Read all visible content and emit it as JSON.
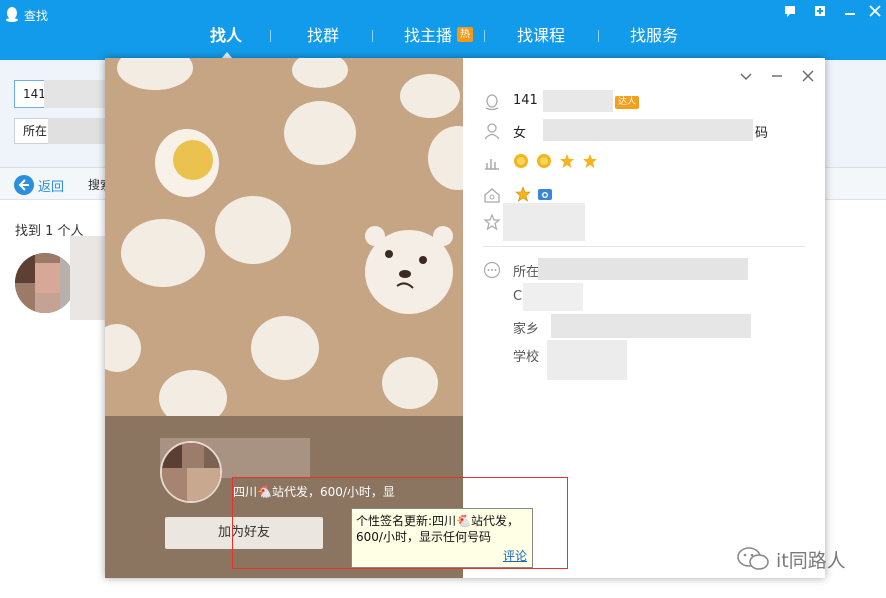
{
  "window": {
    "title": "查找"
  },
  "nav": {
    "tabs": [
      {
        "label": "找人",
        "active": true
      },
      {
        "label": "找群",
        "active": false
      },
      {
        "label": "找主播",
        "active": false
      },
      {
        "label": "找课程",
        "active": false
      },
      {
        "label": "找服务",
        "active": false
      }
    ],
    "hot_badge": "热"
  },
  "search": {
    "query_prefix": "141",
    "location_prefix": "所在"
  },
  "toolbar": {
    "back_label": "返回",
    "crumb_prefix": "搜索"
  },
  "results": {
    "count_text": "找到 1 个人"
  },
  "profile": {
    "qq_prefix": "141",
    "talent_badge": "达人",
    "gender": "女",
    "gender_suffix": "码",
    "level_icons": [
      "sun-icon",
      "sun-icon",
      "star-icon",
      "star-icon"
    ],
    "badges_row": [
      "star-icon",
      "camera-icon"
    ],
    "signature_short": "四川🐔站代发，600/小时，显",
    "add_friend_label": "加为好友",
    "labels": {
      "location": "所在",
      "company_initial": "C",
      "hometown": "家乡",
      "school": "学校"
    }
  },
  "tooltip": {
    "text": "个性签名更新:四川🐔站代发，600/小时，显示任何号码",
    "link": "评论"
  },
  "watermark": {
    "text": "it同路人"
  },
  "colors": {
    "topbar": "#129bea",
    "highlight": "#e6332a",
    "cover": "#c6a584",
    "cover_bottom": "#8b7561"
  }
}
